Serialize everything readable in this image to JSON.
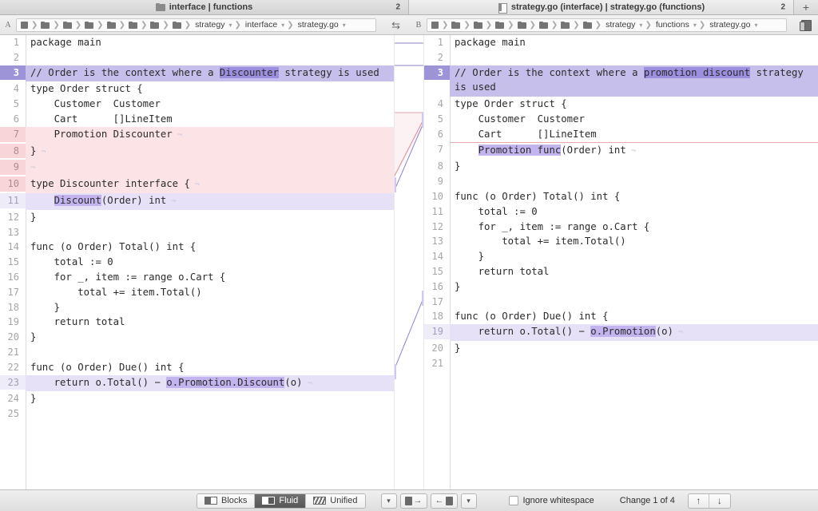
{
  "titlebar": {
    "left_tab": {
      "icon": "folder-icon",
      "title": "interface | functions",
      "count": "2"
    },
    "right_tab": {
      "icon": "file-icon",
      "title": "strategy.go (interface) | strategy.go (functions)",
      "count": "2"
    },
    "add_tab_label": "+"
  },
  "breadcrumbs": {
    "left": {
      "side_label": "A",
      "path": [
        "strategy",
        "interface",
        "strategy.go"
      ],
      "folder_icons": 8
    },
    "right": {
      "side_label": "B",
      "path": [
        "strategy",
        "functions",
        "strategy.go"
      ],
      "folder_icons": 8
    },
    "swap_icon": "swap-arrows-icon",
    "trash_icon": "archive-icon"
  },
  "left_pane": {
    "label": "A",
    "lines": [
      {
        "n": "1",
        "state": "none",
        "segs": [
          {
            "t": "package main"
          }
        ]
      },
      {
        "n": "2",
        "state": "none",
        "segs": []
      },
      {
        "n": "3",
        "state": "chg",
        "segs": [
          {
            "t": "// Order is the context where a "
          },
          {
            "t": "Discounter",
            "h": "strong"
          },
          {
            "t": " strategy is used"
          },
          {
            "t": " ¬",
            "h": "pilcrow"
          }
        ]
      },
      {
        "n": "4",
        "state": "none",
        "segs": [
          {
            "t": "type Order struct {"
          }
        ]
      },
      {
        "n": "5",
        "state": "none",
        "segs": [
          {
            "t": "    Customer  Customer"
          }
        ]
      },
      {
        "n": "6",
        "state": "none",
        "segs": [
          {
            "t": "    Cart      []LineItem"
          }
        ]
      },
      {
        "n": "7",
        "state": "del",
        "segs": [
          {
            "t": "    Promotion Discounter"
          },
          {
            "t": " ¬",
            "h": "pilcrow"
          }
        ]
      },
      {
        "n": "8",
        "state": "del",
        "segs": [
          {
            "t": "}"
          },
          {
            "t": " ¬",
            "h": "pilcrow"
          }
        ]
      },
      {
        "n": "9",
        "state": "del",
        "segs": [
          {
            "t": "¬",
            "h": "pilcrow"
          }
        ]
      },
      {
        "n": "10",
        "state": "del",
        "segs": [
          {
            "t": "type Discounter interface {"
          },
          {
            "t": " ¬",
            "h": "pilcrow"
          }
        ]
      },
      {
        "n": "11",
        "state": "mod",
        "segs": [
          {
            "t": "    "
          },
          {
            "t": "Discount",
            "h": "soft"
          },
          {
            "t": "(Order) int"
          },
          {
            "t": " ¬",
            "h": "pilcrow"
          }
        ]
      },
      {
        "n": "12",
        "state": "none",
        "segs": [
          {
            "t": "}"
          }
        ]
      },
      {
        "n": "13",
        "state": "none",
        "segs": []
      },
      {
        "n": "14",
        "state": "none",
        "segs": [
          {
            "t": "func (o Order) Total() int {"
          }
        ]
      },
      {
        "n": "15",
        "state": "none",
        "segs": [
          {
            "t": "    total := 0"
          }
        ]
      },
      {
        "n": "16",
        "state": "none",
        "segs": [
          {
            "t": "    for _, item := range o.Cart {"
          }
        ]
      },
      {
        "n": "17",
        "state": "none",
        "segs": [
          {
            "t": "        total += item.Total()"
          }
        ]
      },
      {
        "n": "18",
        "state": "none",
        "segs": [
          {
            "t": "    }"
          }
        ]
      },
      {
        "n": "19",
        "state": "none",
        "segs": [
          {
            "t": "    return total"
          }
        ]
      },
      {
        "n": "20",
        "state": "none",
        "segs": [
          {
            "t": "}"
          }
        ]
      },
      {
        "n": "21",
        "state": "none",
        "segs": []
      },
      {
        "n": "22",
        "state": "none",
        "segs": [
          {
            "t": "func (o Order) Due() int {"
          }
        ]
      },
      {
        "n": "23",
        "state": "mod",
        "segs": [
          {
            "t": "    return o.Total() − "
          },
          {
            "t": "o.Promotion.Discount",
            "h": "soft"
          },
          {
            "t": "(o)"
          },
          {
            "t": " ¬",
            "h": "pilcrow"
          }
        ]
      },
      {
        "n": "24",
        "state": "none",
        "segs": [
          {
            "t": "}"
          }
        ]
      },
      {
        "n": "25",
        "state": "none",
        "segs": []
      }
    ]
  },
  "right_pane": {
    "label": "B",
    "lines": [
      {
        "n": "1",
        "state": "none",
        "segs": [
          {
            "t": "package main"
          }
        ]
      },
      {
        "n": "2",
        "state": "none",
        "segs": []
      },
      {
        "n": "3",
        "state": "chg",
        "segs": [
          {
            "t": "// Order is the context where a "
          },
          {
            "t": "promotion discount",
            "h": "strong"
          },
          {
            "t": " strategy is used"
          },
          {
            "t": " ¬",
            "h": "pilcrow"
          }
        ]
      },
      {
        "n": "4",
        "state": "none",
        "segs": [
          {
            "t": "type Order struct {"
          }
        ]
      },
      {
        "n": "5",
        "state": "none",
        "segs": [
          {
            "t": "    Customer  Customer"
          }
        ]
      },
      {
        "n": "6",
        "state": "none",
        "segs": [
          {
            "t": "    Cart      []LineItem"
          }
        ]
      },
      {
        "n": "7",
        "state": "modtop",
        "segs": [
          {
            "t": "    "
          },
          {
            "t": "Promotion func",
            "h": "soft"
          },
          {
            "t": "(Order) int"
          },
          {
            "t": " ¬",
            "h": "pilcrow"
          }
        ]
      },
      {
        "n": "8",
        "state": "none",
        "segs": [
          {
            "t": "}"
          }
        ]
      },
      {
        "n": "9",
        "state": "none",
        "segs": []
      },
      {
        "n": "10",
        "state": "none",
        "segs": [
          {
            "t": "func (o Order) Total() int {"
          }
        ]
      },
      {
        "n": "11",
        "state": "none",
        "segs": [
          {
            "t": "    total := 0"
          }
        ]
      },
      {
        "n": "12",
        "state": "none",
        "segs": [
          {
            "t": "    for _, item := range o.Cart {"
          }
        ]
      },
      {
        "n": "13",
        "state": "none",
        "segs": [
          {
            "t": "        total += item.Total()"
          }
        ]
      },
      {
        "n": "14",
        "state": "none",
        "segs": [
          {
            "t": "    }"
          }
        ]
      },
      {
        "n": "15",
        "state": "none",
        "segs": [
          {
            "t": "    return total"
          }
        ]
      },
      {
        "n": "16",
        "state": "none",
        "segs": [
          {
            "t": "}"
          }
        ]
      },
      {
        "n": "17",
        "state": "none",
        "segs": []
      },
      {
        "n": "18",
        "state": "none",
        "segs": [
          {
            "t": "func (o Order) Due() int {"
          }
        ]
      },
      {
        "n": "19",
        "state": "mod",
        "segs": [
          {
            "t": "    return o.Total() − "
          },
          {
            "t": "o.Promotion",
            "h": "soft"
          },
          {
            "t": "(o)"
          },
          {
            "t": " ¬",
            "h": "pilcrow"
          }
        ]
      },
      {
        "n": "20",
        "state": "none",
        "segs": [
          {
            "t": "}"
          }
        ]
      },
      {
        "n": "21",
        "state": "none",
        "segs": []
      }
    ]
  },
  "bottombar": {
    "view_modes": [
      {
        "label": "Blocks",
        "icon": "blocks-icon",
        "selected": false
      },
      {
        "label": "Fluid",
        "icon": "fluid-icon",
        "selected": true
      },
      {
        "label": "Unified",
        "icon": "unified-icon",
        "selected": false
      }
    ],
    "merge_left_dropdown": "▾",
    "merge_to_right": "→",
    "merge_to_left": "←",
    "merge_right_dropdown": "▾",
    "ignore_whitespace_label": "Ignore whitespace",
    "ignore_whitespace_checked": false,
    "change_status": "Change 1 of 4",
    "prev_change": "↑",
    "next_change": "↓"
  },
  "colors": {
    "changed_gutter": "#9d94d8",
    "changed_bg": "#c6bfeb",
    "deleted_bg": "#fbe3e6",
    "modified_bg": "#e6e1f7",
    "highlight_strong": "#9d8fe0",
    "highlight_soft": "#c3b4ef"
  }
}
